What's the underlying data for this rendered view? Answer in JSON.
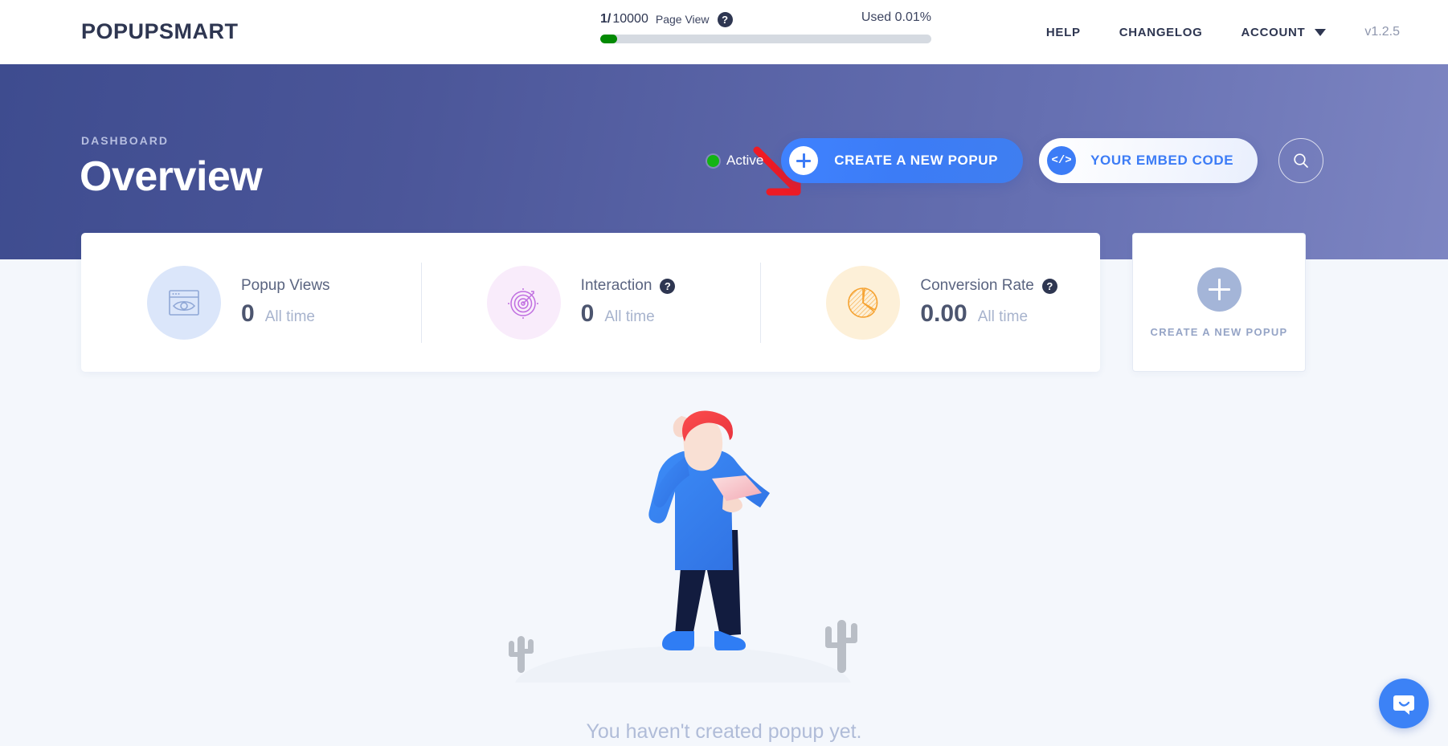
{
  "header": {
    "logo": "POPUPSMART",
    "usage": {
      "count": "1",
      "separator": "/",
      "total": "10000",
      "label": "Page View",
      "help_icon": "?",
      "used": "Used 0.01%",
      "progress_percent": 5,
      "progress_color": "#038a03",
      "track_color": "#d5dae1"
    },
    "nav": {
      "help": "HELP",
      "changelog": "CHANGELOG",
      "account": "ACCOUNT",
      "version": "v1.2.5"
    }
  },
  "hero": {
    "kicker": "DASHBOARD",
    "title": "Overview",
    "status_label": "Active",
    "status_color": "#13b413",
    "create_button": "CREATE A NEW POPUP",
    "embed_button": "YOUR EMBED CODE",
    "embed_icon_text": "</>",
    "accent_color": "#3c7cf6",
    "annotation_color": "#ee1b24"
  },
  "stats": [
    {
      "title": "Popup Views",
      "value": "0",
      "period": "All time",
      "has_help": false,
      "help_icon": "",
      "icon_name": "browser-eye-icon",
      "icon_bg": "#dbe6fa",
      "icon_stroke": "#8fa7d6"
    },
    {
      "title": "Interaction",
      "value": "0",
      "period": "All time",
      "has_help": true,
      "help_icon": "?",
      "icon_name": "target-icon",
      "icon_bg": "#f9ecfb",
      "icon_stroke": "#c06ee0"
    },
    {
      "title": "Conversion Rate",
      "value": "0.00",
      "period": "All time",
      "has_help": true,
      "help_icon": "?",
      "icon_name": "pie-chart-icon",
      "icon_bg": "#fdf0d8",
      "icon_stroke": "#f6a332"
    }
  ],
  "create_card": {
    "label": "CREATE A NEW POPUP"
  },
  "empty_state": {
    "message": "You haven't created popup yet."
  },
  "chat": {
    "label": "chat-bubble-icon"
  }
}
